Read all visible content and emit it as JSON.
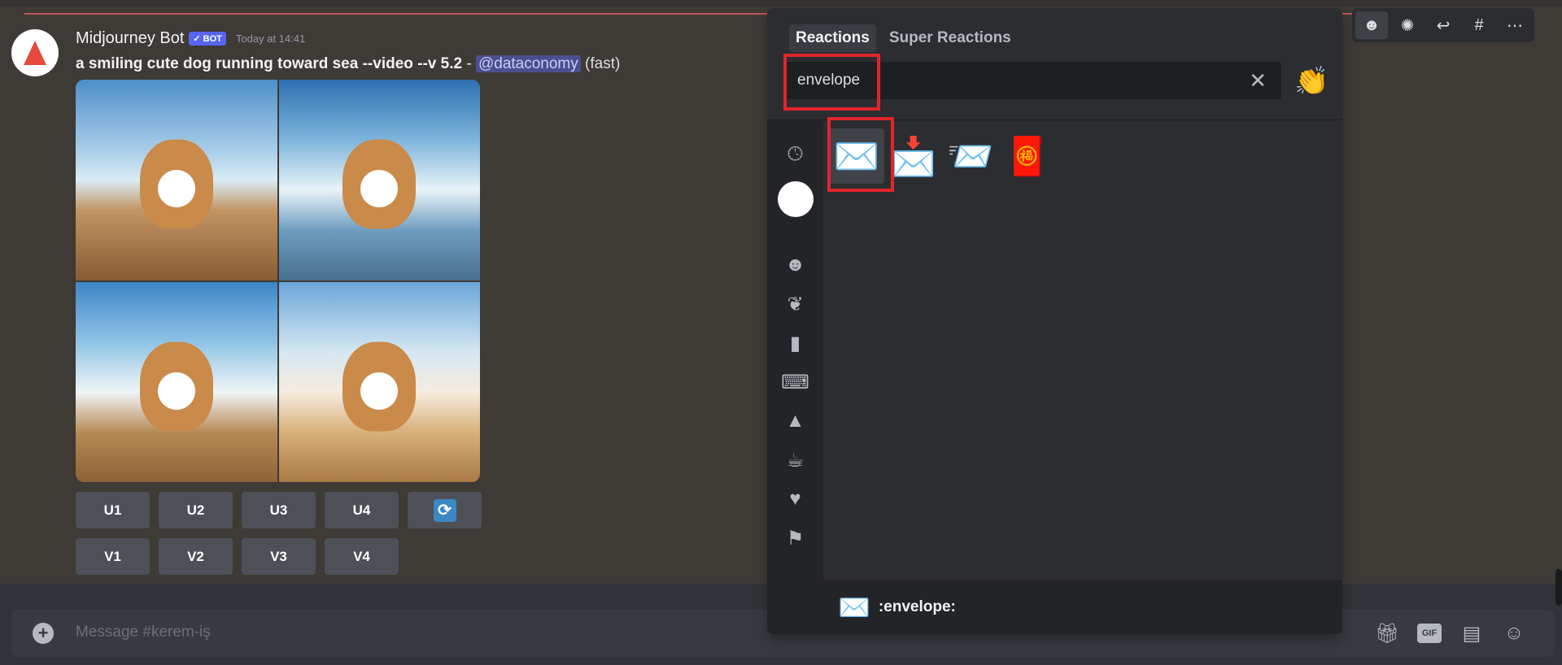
{
  "message": {
    "author": "Midjourney Bot",
    "badge": "✓ BOT",
    "timestamp": "Today at 14:41",
    "prompt": "a smiling cute dog running toward sea --video --v 5.2",
    "separator": " - ",
    "mention": "@dataconomy",
    "mode": "(fast)",
    "upscale_buttons": [
      "U1",
      "U2",
      "U3",
      "U4"
    ],
    "variation_buttons": [
      "V1",
      "V2",
      "V3",
      "V4"
    ],
    "reroll_icon": "🔄"
  },
  "composer": {
    "placeholder": "Message #kerem-iş",
    "gif_label": "GIF"
  },
  "picker": {
    "tabs": [
      "Reactions",
      "Super Reactions"
    ],
    "search_value": "envelope",
    "skin_tone_icon": "👏",
    "results": [
      "✉️",
      "📩",
      "📨",
      "🧧"
    ],
    "footer_emoji": "✉️",
    "footer_name": ":envelope:"
  },
  "colors": {
    "accent": "#5865f2",
    "highlight": "#e0252b",
    "mention_bg": "#4c4f8f"
  }
}
